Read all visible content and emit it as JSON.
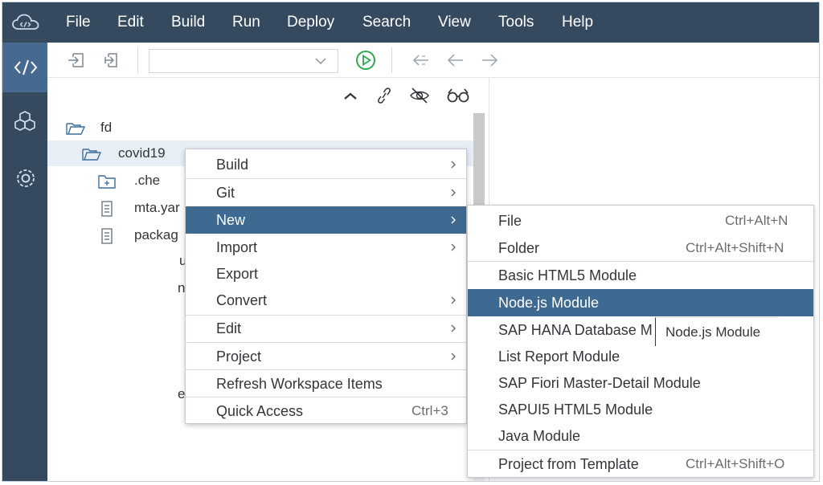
{
  "menubar": {
    "items": [
      "File",
      "Edit",
      "Build",
      "Run",
      "Deploy",
      "Search",
      "View",
      "Tools",
      "Help"
    ]
  },
  "tree": {
    "root": "fd",
    "project": "covid19",
    "children": [
      ".che",
      "mta.yar",
      "packag"
    ],
    "fragments": [
      "u",
      "ni",
      "e"
    ]
  },
  "context_menu": {
    "items": [
      {
        "label": "Build",
        "submenu": true
      },
      {
        "label": "Git",
        "submenu": true
      },
      {
        "label": "New",
        "submenu": true,
        "highlighted": true
      },
      {
        "label": "Import",
        "submenu": true
      },
      {
        "label": "Export",
        "submenu": false
      },
      {
        "label": "Convert",
        "submenu": true
      },
      {
        "label": "Edit",
        "submenu": true
      },
      {
        "label": "Project",
        "submenu": true
      },
      {
        "label": "Refresh Workspace Items",
        "submenu": false
      },
      {
        "label": "Quick Access",
        "shortcut": "Ctrl+3"
      }
    ]
  },
  "new_submenu": {
    "items": [
      {
        "label": "File",
        "shortcut": "Ctrl+Alt+N"
      },
      {
        "label": "Folder",
        "shortcut": "Ctrl+Alt+Shift+N"
      },
      {
        "label": "Basic HTML5 Module"
      },
      {
        "label": "Node.js Module",
        "highlighted": true
      },
      {
        "label": "SAP HANA Database M"
      },
      {
        "label": "List Report Module"
      },
      {
        "label": "SAP Fiori Master-Detail Module"
      },
      {
        "label": "SAPUI5 HTML5 Module"
      },
      {
        "label": "Java Module"
      },
      {
        "label": "Project from Template",
        "shortcut": "Ctrl+Alt+Shift+O"
      }
    ]
  },
  "tooltip": "Node.js Module",
  "colors": {
    "shell": "#354a5f",
    "active": "#466a8f",
    "highlight": "#3e6a92",
    "run_green": "#2fa84f"
  },
  "icons": {
    "logo": "cloud-code-icon",
    "activity": [
      "code-icon",
      "package-icon",
      "gear-icon"
    ],
    "toolbar": [
      "import-icon",
      "export-icon",
      "run-icon",
      "back-history-icon",
      "back-icon",
      "forward-icon"
    ],
    "panel": [
      "collapse-icon",
      "link-icon",
      "hide-icon",
      "glasses-icon"
    ]
  }
}
